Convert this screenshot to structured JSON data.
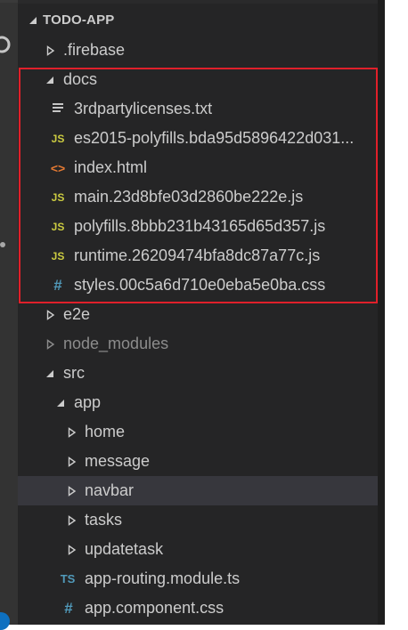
{
  "explorer": {
    "section_title": "TODO-APP",
    "items": [
      {
        "label": ".firebase",
        "kind": "folder",
        "expanded": false
      },
      {
        "label": "docs",
        "kind": "folder",
        "expanded": true
      },
      {
        "label": "3rdpartylicenses.txt",
        "kind": "file",
        "icon": "text-file-icon"
      },
      {
        "label": "es2015-polyfills.bda95d5896422d031...",
        "kind": "file",
        "icon": "js-file-icon",
        "icon_text": "JS"
      },
      {
        "label": "index.html",
        "kind": "file",
        "icon": "html-file-icon",
        "icon_text": "<>"
      },
      {
        "label": "main.23d8bfe03d2860be222e.js",
        "kind": "file",
        "icon": "js-file-icon",
        "icon_text": "JS"
      },
      {
        "label": "polyfills.8bbb231b43165d65d357.js",
        "kind": "file",
        "icon": "js-file-icon",
        "icon_text": "JS"
      },
      {
        "label": "runtime.26209474bfa8dc87a77c.js",
        "kind": "file",
        "icon": "js-file-icon",
        "icon_text": "JS"
      },
      {
        "label": "styles.00c5a6d710e0eba5e0ba.css",
        "kind": "file",
        "icon": "css-file-icon",
        "icon_text": "#"
      },
      {
        "label": "e2e",
        "kind": "folder",
        "expanded": false
      },
      {
        "label": "node_modules",
        "kind": "folder",
        "expanded": false,
        "dimmed": true
      },
      {
        "label": "src",
        "kind": "folder",
        "expanded": true
      },
      {
        "label": "app",
        "kind": "folder",
        "expanded": true
      },
      {
        "label": "home",
        "kind": "folder",
        "expanded": false
      },
      {
        "label": "message",
        "kind": "folder",
        "expanded": false
      },
      {
        "label": "navbar",
        "kind": "folder",
        "expanded": false,
        "selected": true
      },
      {
        "label": "tasks",
        "kind": "folder",
        "expanded": false
      },
      {
        "label": "updatetask",
        "kind": "folder",
        "expanded": false
      },
      {
        "label": "app-routing.module.ts",
        "kind": "file",
        "icon": "ts-file-icon",
        "icon_text": "TS"
      },
      {
        "label": "app.component.css",
        "kind": "file",
        "icon": "css-file-icon",
        "icon_text": "#"
      }
    ]
  },
  "colors": {
    "sidebar_bg": "#252526",
    "text": "#cccccc",
    "selected_row": "#37373d",
    "highlight_border": "#e0202a",
    "js_icon": "#cbcb41",
    "css_icon": "#519aba",
    "html_icon": "#e37933"
  }
}
